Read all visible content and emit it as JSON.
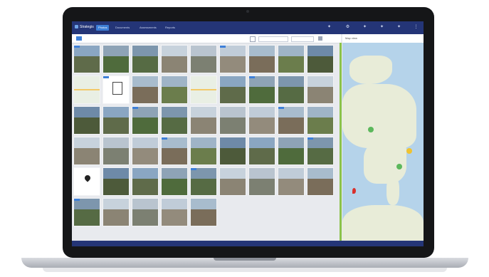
{
  "app": {
    "logo_text": "Strategis",
    "tabs": [
      "Photos",
      "Documents",
      "Assessments",
      "Reports"
    ],
    "active_tab": 0
  },
  "toolbar": {
    "left_label": "",
    "sort_label": "",
    "view_label": ""
  },
  "map": {
    "header": "Map view",
    "zoom_label": ""
  },
  "status": {
    "text": ""
  },
  "colors": {
    "topbar": "#243577",
    "accent": "#3d7fd8",
    "map_water": "#b5d3ea",
    "map_land": "#e8ecd8",
    "marker_green": "#5cb85c",
    "marker_yellow": "#f0c330",
    "marker_red": "#d9302c"
  },
  "icons": [
    "user-icon",
    "settings-icon",
    "bell-icon",
    "help-icon",
    "more-icon"
  ],
  "grid_tiles": [
    "photo",
    "photo",
    "photo",
    "photo",
    "photo",
    "photo",
    "photo",
    "photo",
    "photo",
    "map",
    "doc",
    "photo",
    "photo",
    "map",
    "photo",
    "photo",
    "photo",
    "photo",
    "photo",
    "photo",
    "photo",
    "photo",
    "photo",
    "photo",
    "photo",
    "photo",
    "photo",
    "photo",
    "photo",
    "photo",
    "photo",
    "photo",
    "photo",
    "photo",
    "photo",
    "photo",
    "pin",
    "photo",
    "photo",
    "photo",
    "photo",
    "photo",
    "photo",
    "photo",
    "photo",
    "photo",
    "photo",
    "photo",
    "photo",
    "photo"
  ]
}
